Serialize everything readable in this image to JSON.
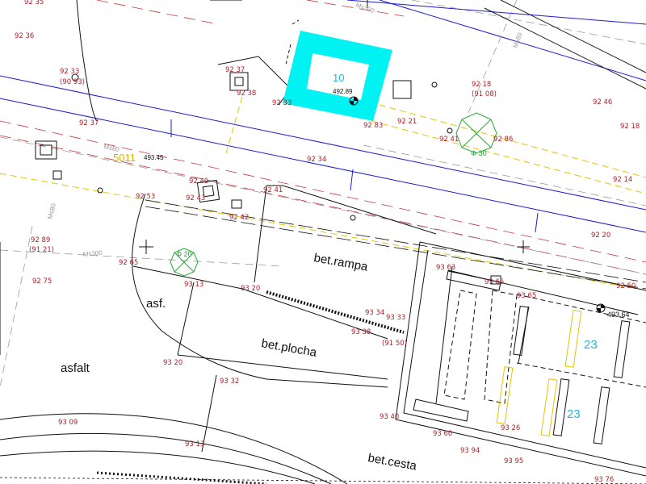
{
  "map": {
    "labels": {
      "bet_rampa": "bet.rampa",
      "bet_plocha": "bet.plocha",
      "bet_cesta": "bet.cesta",
      "asfalt": "asfalt",
      "asf": "asf.",
      "building_number": "10",
      "parking_a": "23",
      "parking_b": "23",
      "code_5011": "5011",
      "tree_a": "Φ 20",
      "tree_b": "Φ 20",
      "tree_c": "Φ 30",
      "ms_a": "Ms80",
      "ms_b": "Ms300",
      "ms_c": "Ms80",
      "ms_d": "Ms300",
      "ms_e": "Ms80"
    },
    "point_elevations": [
      {
        "id": "p1",
        "text": "492.89"
      },
      {
        "id": "p2",
        "text": "493.64"
      },
      {
        "id": "p3",
        "text": "493.45"
      }
    ],
    "spot_heights": [
      "92 35",
      "92 36",
      "92 33",
      "(90 93)",
      "92 37",
      "92 37",
      "92 38",
      "92 33",
      "92 83",
      "92 21",
      "92 18",
      "(91 08)",
      "92 86",
      "92 41",
      "92 46",
      "92 18",
      "92 14",
      "92 34",
      "92 42",
      "92 43",
      "92 49",
      "92 53",
      "92 41",
      "92 89",
      "(91 21)",
      "92 65",
      "92 75",
      "93 13",
      "93 20",
      "93 63",
      "93 65",
      "93 65",
      "93 34",
      "93 33",
      "93 38",
      "(91 50)",
      "93 20",
      "93 32",
      "93 40",
      "93 60",
      "93 09",
      "93 13",
      "92 20",
      "92 50",
      "93 94",
      "93 95",
      "93 76",
      "93 26"
    ],
    "colors": {
      "linework": "#111111",
      "survey_text": "#b0202a",
      "highlight": "#00f2f2",
      "road_axis": "#1a1ad8",
      "utility": "#e5c400",
      "tree": "#2aa83a",
      "gas_line": "#9a9a9a"
    }
  }
}
